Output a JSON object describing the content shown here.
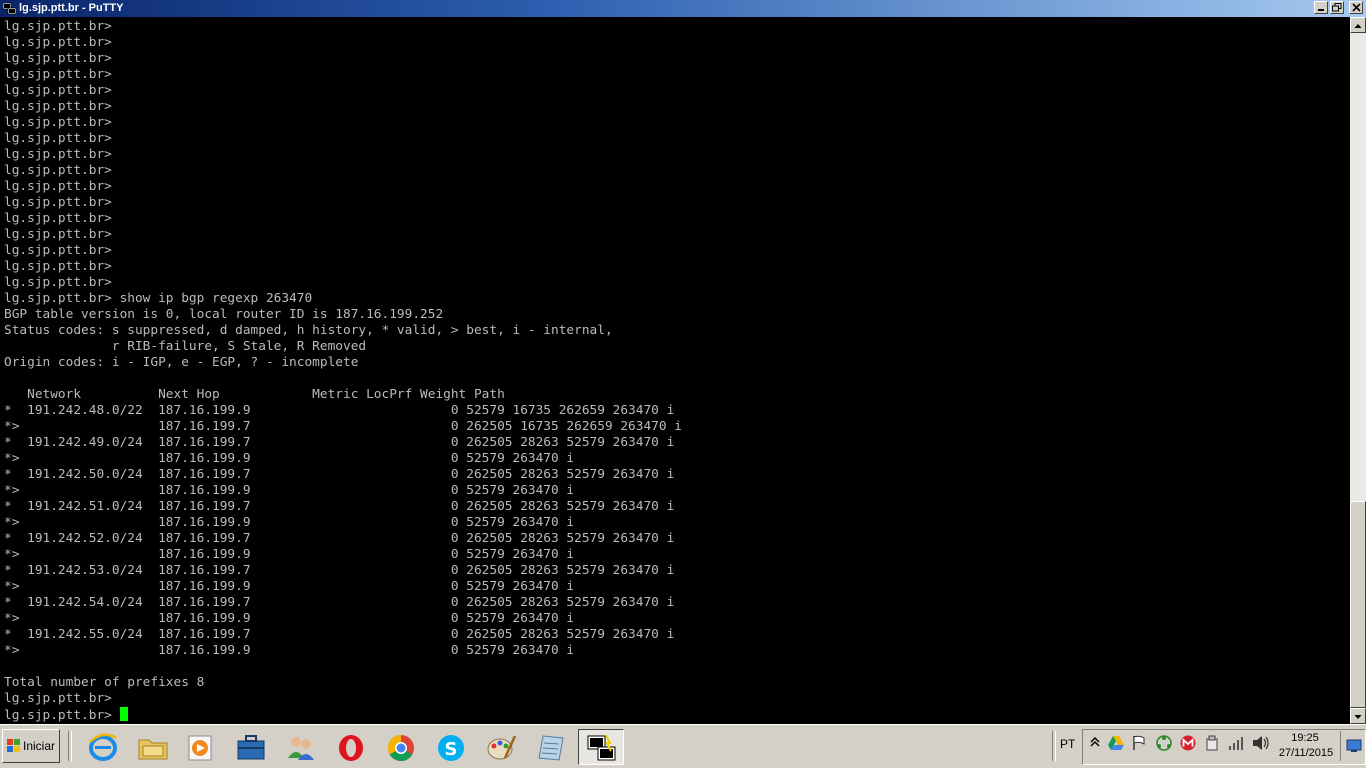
{
  "window": {
    "title": "lg.sjp.ptt.br - PuTTY"
  },
  "terminal": {
    "lines": [
      "lg.sjp.ptt.br>",
      "lg.sjp.ptt.br>",
      "lg.sjp.ptt.br>",
      "lg.sjp.ptt.br>",
      "lg.sjp.ptt.br>",
      "lg.sjp.ptt.br>",
      "lg.sjp.ptt.br>",
      "lg.sjp.ptt.br>",
      "lg.sjp.ptt.br>",
      "lg.sjp.ptt.br>",
      "lg.sjp.ptt.br>",
      "lg.sjp.ptt.br>",
      "lg.sjp.ptt.br>",
      "lg.sjp.ptt.br>",
      "lg.sjp.ptt.br>",
      "lg.sjp.ptt.br>",
      "lg.sjp.ptt.br>",
      "lg.sjp.ptt.br> show ip bgp regexp 263470",
      "BGP table version is 0, local router ID is 187.16.199.252",
      "Status codes: s suppressed, d damped, h history, * valid, > best, i - internal,",
      "              r RIB-failure, S Stale, R Removed",
      "Origin codes: i - IGP, e - EGP, ? - incomplete",
      "",
      "   Network          Next Hop            Metric LocPrf Weight Path",
      "*  191.242.48.0/22  187.16.199.9                          0 52579 16735 262659 263470 i",
      "*>                  187.16.199.7                          0 262505 16735 262659 263470 i",
      "*  191.242.49.0/24  187.16.199.7                          0 262505 28263 52579 263470 i",
      "*>                  187.16.199.9                          0 52579 263470 i",
      "*  191.242.50.0/24  187.16.199.7                          0 262505 28263 52579 263470 i",
      "*>                  187.16.199.9                          0 52579 263470 i",
      "*  191.242.51.0/24  187.16.199.7                          0 262505 28263 52579 263470 i",
      "*>                  187.16.199.9                          0 52579 263470 i",
      "*  191.242.52.0/24  187.16.199.7                          0 262505 28263 52579 263470 i",
      "*>                  187.16.199.9                          0 52579 263470 i",
      "*  191.242.53.0/24  187.16.199.7                          0 262505 28263 52579 263470 i",
      "*>                  187.16.199.9                          0 52579 263470 i",
      "*  191.242.54.0/24  187.16.199.7                          0 262505 28263 52579 263470 i",
      "*>                  187.16.199.9                          0 52579 263470 i",
      "*  191.242.55.0/24  187.16.199.7                          0 262505 28263 52579 263470 i",
      "*>                  187.16.199.9                          0 52579 263470 i",
      "",
      "Total number of prefixes 8",
      "lg.sjp.ptt.br>",
      "lg.sjp.ptt.br> "
    ],
    "foreground": "#bbbbbb",
    "background": "#000000",
    "cursor_color": "#00ff00"
  },
  "taskbar": {
    "start_label": "Iniciar",
    "apps": [
      {
        "icon": "internet-explorer-icon"
      },
      {
        "icon": "file-explorer-icon"
      },
      {
        "icon": "media-player-icon"
      },
      {
        "icon": "briefcase-icon"
      },
      {
        "icon": "users-icon"
      },
      {
        "icon": "opera-icon"
      },
      {
        "icon": "chrome-icon"
      },
      {
        "icon": "skype-icon"
      },
      {
        "icon": "paint-icon"
      },
      {
        "icon": "notepad-icon"
      },
      {
        "icon": "putty-icon",
        "active": true
      }
    ],
    "language": "PT",
    "clock_time": "19:25",
    "clock_date": "27/11/2015"
  }
}
